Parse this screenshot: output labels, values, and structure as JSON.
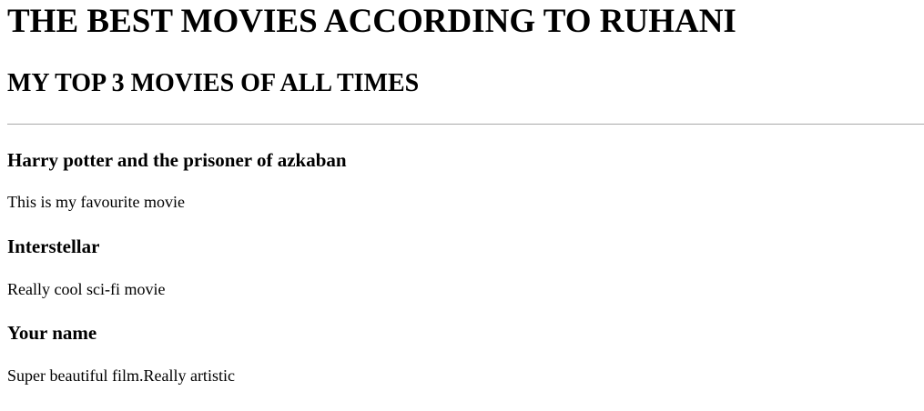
{
  "header": {
    "title": "THE BEST MOVIES ACCORDING TO RUHANI",
    "subtitle": "MY TOP 3 MOVIES OF ALL TIMES"
  },
  "movies": [
    {
      "title": "Harry potter and the prisoner of azkaban",
      "description": "This is my favourite movie"
    },
    {
      "title": "Interstellar",
      "description": "Really cool sci-fi movie"
    },
    {
      "title": "Your name",
      "description": "Super beautiful film.Really artistic"
    }
  ],
  "colors": {
    "background": "#ffffff",
    "text": "#000000",
    "divider": "#a9a9a9"
  }
}
